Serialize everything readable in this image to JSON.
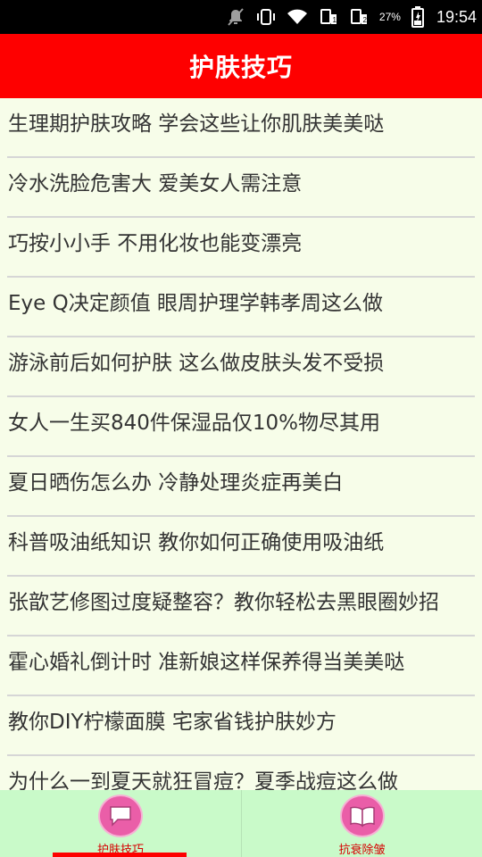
{
  "status_bar": {
    "battery_percent": "27%",
    "time": "19:54"
  },
  "header": {
    "title": "护肤技巧"
  },
  "articles": [
    "生理期护肤攻略 学会这些让你肌肤美美哒",
    "冷水洗脸危害大 爱美女人需注意",
    "巧按小小手 不用化妆也能变漂亮",
    "Eye Q决定颜值 眼周护理学韩孝周这么做",
    "游泳前后如何护肤 这么做皮肤头发不受损",
    "女人一生买840件保湿品仅10%物尽其用",
    "夏日晒伤怎么办 冷静处理炎症再美白",
    "科普吸油纸知识 教你如何正确使用吸油纸",
    "张歆艺修图过度疑整容？教你轻松去黑眼圈妙招",
    "霍心婚礼倒计时 准新娘这样保养得当美美哒",
    "教你DIY柠檬面膜 宅家省钱护肤妙方",
    "为什么一到夏天就狂冒痘？夏季战痘这么做"
  ],
  "bottom_nav": {
    "tabs": [
      {
        "label": "护肤技巧",
        "icon": "chat-bubble-icon",
        "active": true
      },
      {
        "label": "抗衰除皱",
        "icon": "book-icon",
        "active": false
      }
    ]
  },
  "colors": {
    "header_bg": "#fe0000",
    "page_bg": "#f7fde9",
    "nav_bg": "#c9fac9",
    "nav_icon_bg": "#ea5ea8",
    "nav_label": "#d60000"
  }
}
